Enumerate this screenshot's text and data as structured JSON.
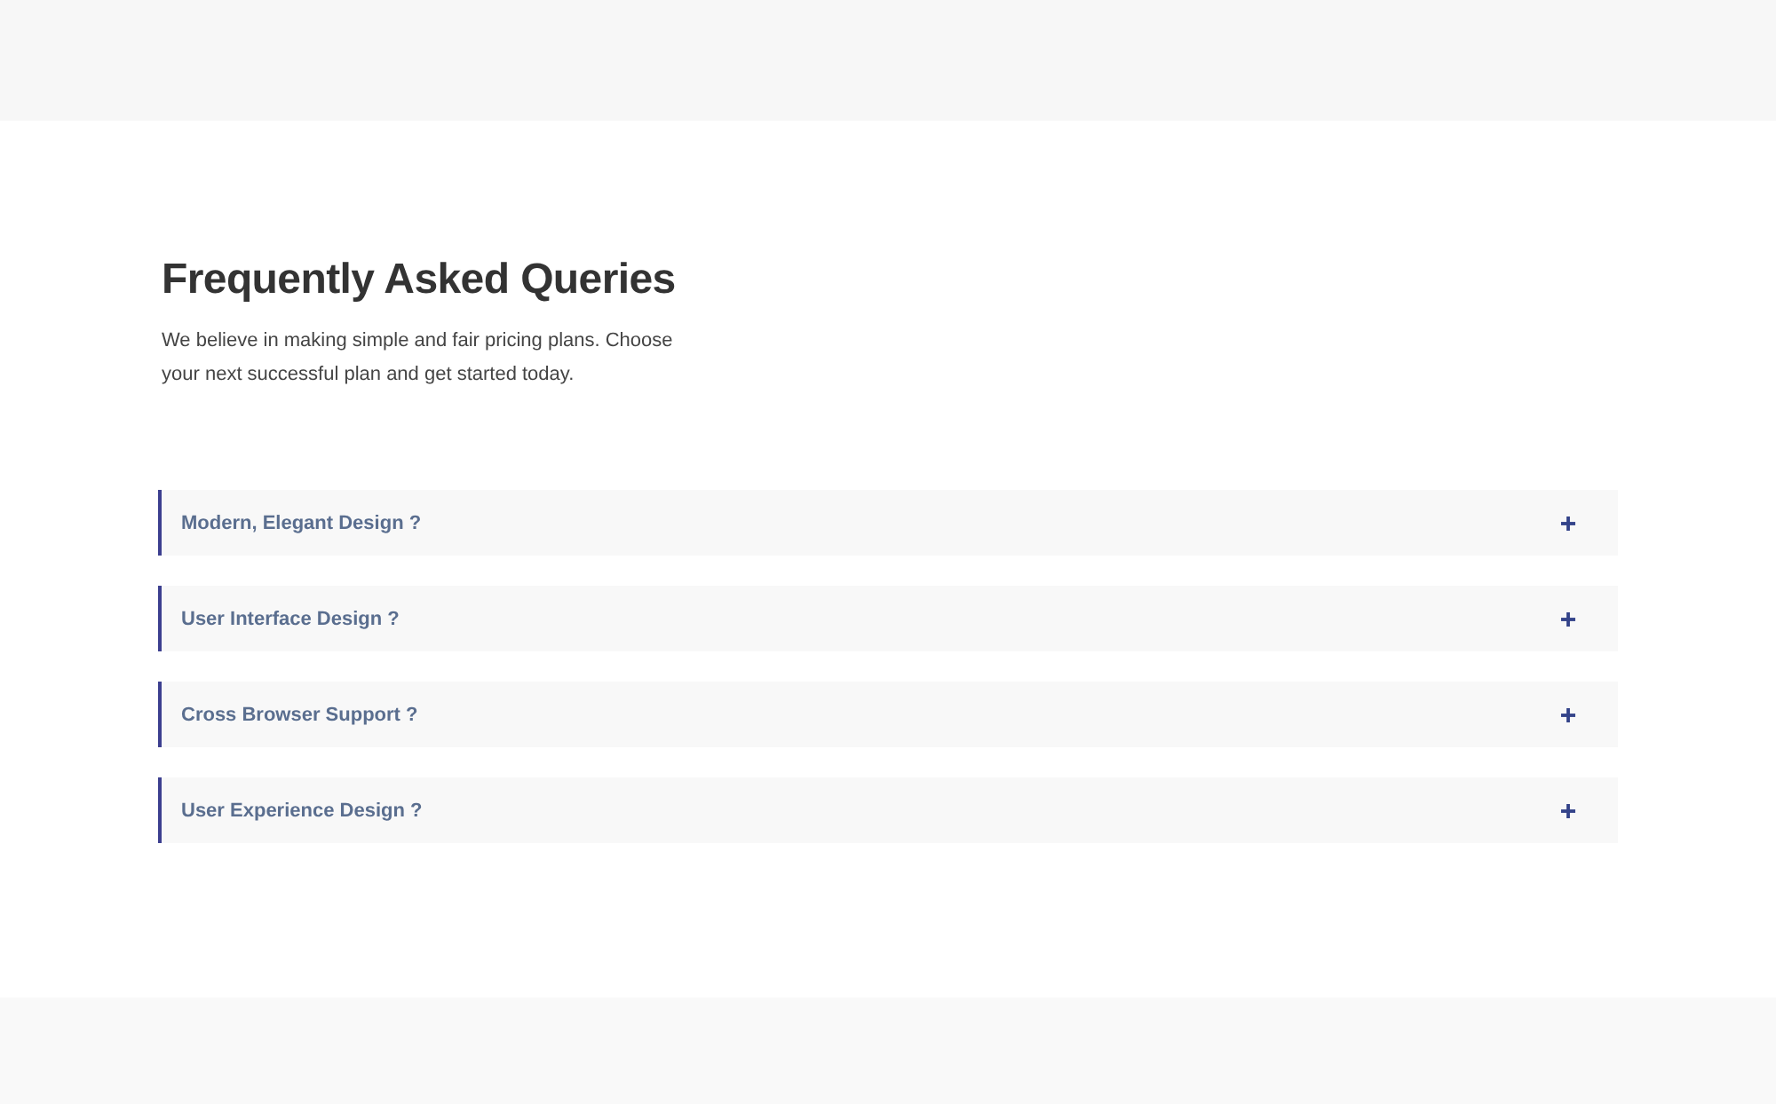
{
  "faq": {
    "title": "Frequently Asked Queries",
    "description": "We believe in making simple and fair pricing plans. Choose your next successful plan and get started today.",
    "items": [
      {
        "question": "Modern, Elegant Design ?",
        "expanded": false
      },
      {
        "question": "User Interface Design ?",
        "expanded": false
      },
      {
        "question": "Cross Browser Support ?",
        "expanded": false
      },
      {
        "question": "User Experience Design ?",
        "expanded": false
      }
    ]
  }
}
